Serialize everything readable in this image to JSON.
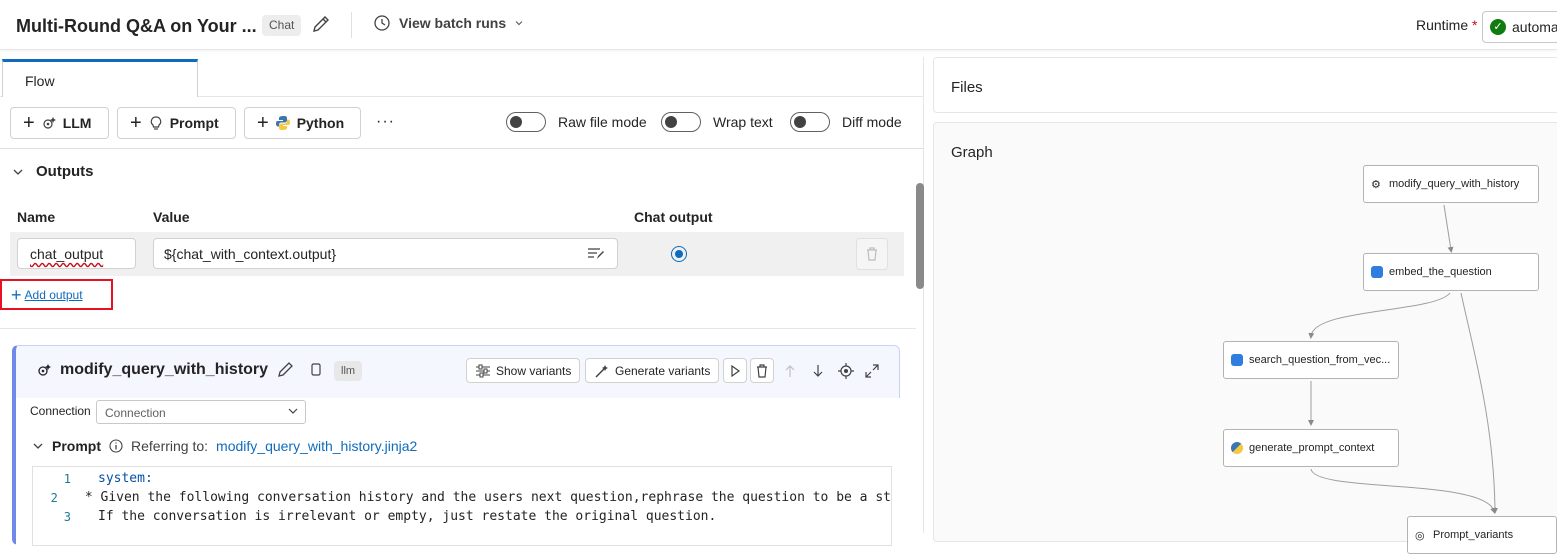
{
  "header": {
    "title": "Multi-Round Q&A on Your ...",
    "badge": "Chat",
    "batch_label": "View batch runs",
    "runtime_label": "Runtime",
    "runtime_required": "*",
    "runtime_value": "automa"
  },
  "tabs": [
    {
      "label": "Flow"
    }
  ],
  "toolbar": {
    "llm_label": "LLM",
    "prompt_label": "Prompt",
    "python_label": "Python",
    "more_label": "···",
    "toggles": [
      {
        "label": "Raw file mode",
        "on": false
      },
      {
        "label": "Wrap text",
        "on": false
      },
      {
        "label": "Diff mode",
        "on": false
      }
    ]
  },
  "outputs": {
    "title": "Outputs",
    "columns": {
      "name": "Name",
      "value": "Value",
      "chat": "Chat output"
    },
    "rows": [
      {
        "name": "chat_output",
        "value": "${chat_with_context.output}",
        "chat_output": true
      }
    ],
    "add_label": "Add output"
  },
  "node": {
    "name": "modify_query_with_history",
    "type": "llm",
    "show_variants": "Show variants",
    "generate_variants": "Generate variants",
    "connection_label": "Connection",
    "connection_placeholder": "Connection",
    "prompt_label": "Prompt",
    "referring_to": "Referring to:",
    "prompt_file": "modify_query_with_history.jinja2",
    "code_lines": [
      {
        "n": "1",
        "text": "system:"
      },
      {
        "n": "2",
        "text": "* Given the following conversation history and the users next question,rephrase the question to be a st"
      },
      {
        "n": "3",
        "text": "If the conversation is irrelevant or empty, just restate the original question."
      }
    ]
  },
  "files": {
    "title": "Files"
  },
  "graph": {
    "title": "Graph",
    "nodes": [
      {
        "label": "modify_query_with_history",
        "icon": "llm-icon"
      },
      {
        "label": "embed_the_question",
        "icon": "embedding-icon"
      },
      {
        "label": "search_question_from_vec...",
        "icon": "vector-search-icon"
      },
      {
        "label": "generate_prompt_context",
        "icon": "python-icon"
      },
      {
        "label": "Prompt_variants",
        "icon": "prompt-icon"
      }
    ]
  }
}
